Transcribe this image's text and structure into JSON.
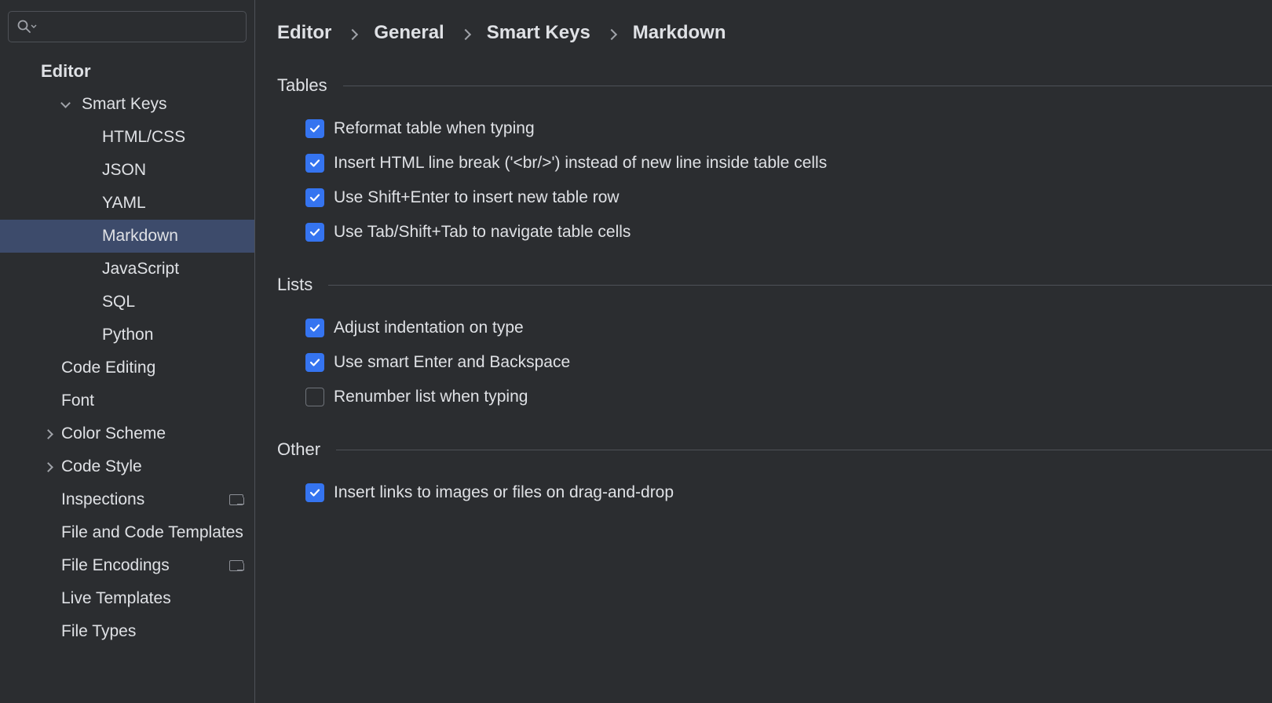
{
  "search": {
    "placeholder": ""
  },
  "sidebar": {
    "root": "Editor",
    "smart_keys": "Smart Keys",
    "items": [
      "HTML/CSS",
      "JSON",
      "YAML",
      "Markdown",
      "JavaScript",
      "SQL",
      "Python"
    ],
    "below": [
      {
        "label": "Code Editing",
        "arrow": false,
        "badge": false
      },
      {
        "label": "Font",
        "arrow": false,
        "badge": false
      },
      {
        "label": "Color Scheme",
        "arrow": true,
        "badge": false
      },
      {
        "label": "Code Style",
        "arrow": true,
        "badge": false
      },
      {
        "label": "Inspections",
        "arrow": false,
        "badge": true
      },
      {
        "label": "File and Code Templates",
        "arrow": false,
        "badge": false
      },
      {
        "label": "File Encodings",
        "arrow": false,
        "badge": true
      },
      {
        "label": "Live Templates",
        "arrow": false,
        "badge": false
      },
      {
        "label": "File Types",
        "arrow": false,
        "badge": false
      }
    ]
  },
  "breadcrumbs": [
    "Editor",
    "General",
    "Smart Keys",
    "Markdown"
  ],
  "sections": {
    "tables": {
      "title": "Tables",
      "opts": [
        {
          "label": "Reformat table when typing",
          "checked": true
        },
        {
          "label": "Insert HTML line break ('<br/>') instead of new line inside table cells",
          "checked": true
        },
        {
          "label": "Use Shift+Enter to insert new table row",
          "checked": true
        },
        {
          "label": "Use Tab/Shift+Tab to navigate table cells",
          "checked": true
        }
      ]
    },
    "lists": {
      "title": "Lists",
      "opts": [
        {
          "label": "Adjust indentation on type",
          "checked": true
        },
        {
          "label": "Use smart Enter and Backspace",
          "checked": true
        },
        {
          "label": "Renumber list when typing",
          "checked": false
        }
      ]
    },
    "other": {
      "title": "Other",
      "opts": [
        {
          "label": "Insert links to images or files on drag-and-drop",
          "checked": true
        }
      ]
    }
  }
}
